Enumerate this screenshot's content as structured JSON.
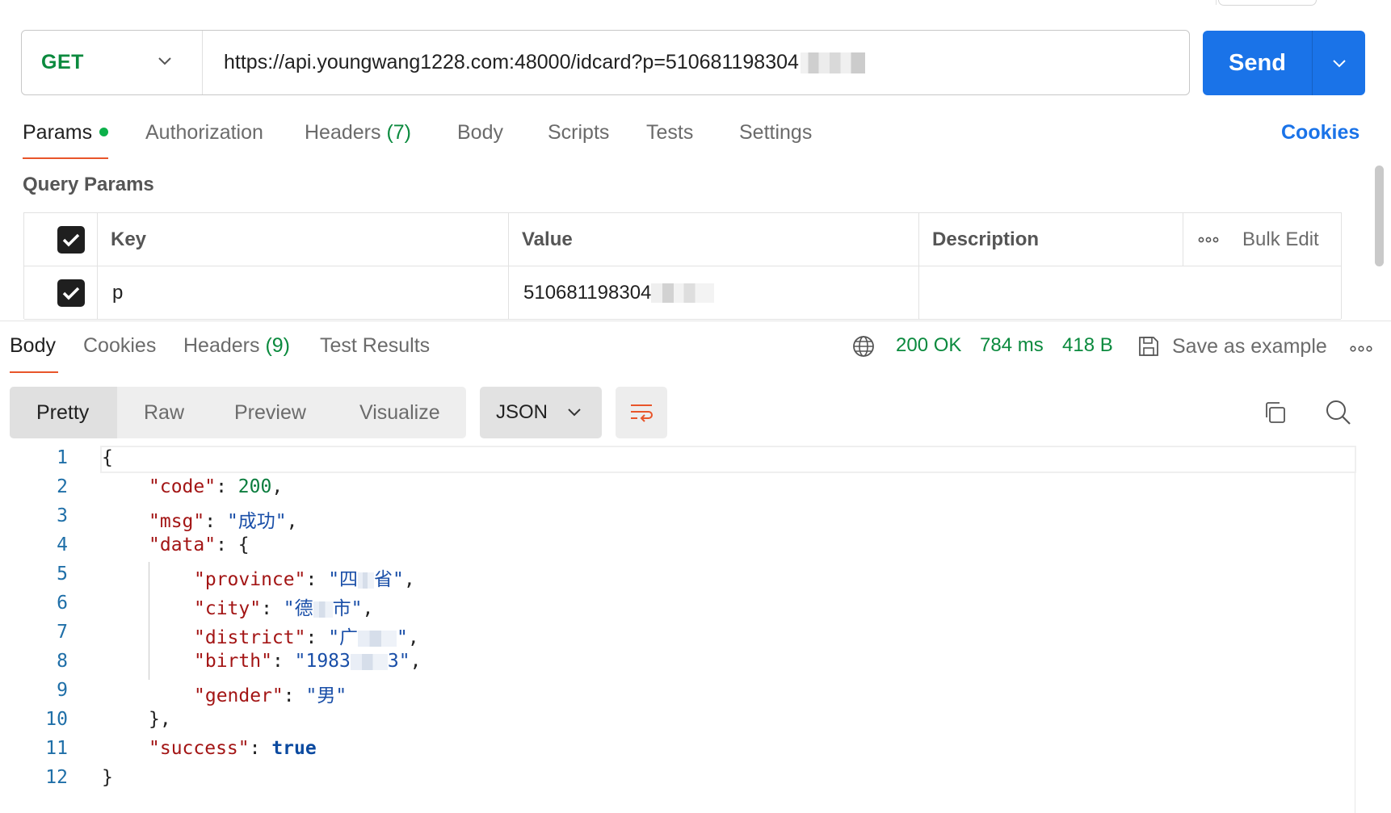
{
  "request": {
    "method": "GET",
    "url": "https://api.youngwang1228.com:48000/idcard?p=510681198304",
    "send_label": "Send"
  },
  "request_tabs": {
    "params": "Params",
    "authorization": "Authorization",
    "headers": "Headers",
    "headers_count": "(7)",
    "body": "Body",
    "scripts": "Scripts",
    "tests": "Tests",
    "settings": "Settings",
    "cookies": "Cookies"
  },
  "query_params": {
    "title": "Query Params",
    "columns": {
      "key": "Key",
      "value": "Value",
      "description": "Description",
      "bulk_edit": "Bulk Edit"
    },
    "rows": [
      {
        "key": "p",
        "value": "510681198304",
        "description": "",
        "checked": true
      }
    ]
  },
  "response": {
    "tabs": {
      "body": "Body",
      "cookies": "Cookies",
      "headers": "Headers",
      "headers_count": "(9)",
      "test_results": "Test Results"
    },
    "status": "200 OK",
    "time": "784 ms",
    "size": "418 B",
    "save_label": "Save as example",
    "view_modes": [
      "Pretty",
      "Raw",
      "Preview",
      "Visualize"
    ],
    "format": "JSON",
    "code": {
      "l1": "{",
      "code_key": "\"code\"",
      "code_val": "200",
      "msg_key": "\"msg\"",
      "msg_val": "\"成功\"",
      "data_key": "\"data\"",
      "province_key": "\"province\"",
      "province_a": "\"四",
      "province_b": "省\"",
      "city_key": "\"city\"",
      "city_a": "\"德",
      "city_b": "市\"",
      "district_key": "\"district\"",
      "district_a": "\"广",
      "district_b": "\"",
      "birth_key": "\"birth\"",
      "birth_a": "\"1983",
      "birth_b": "3\"",
      "gender_key": "\"gender\"",
      "gender_val": "\"男\"",
      "data_close": "},",
      "success_key": "\"success\"",
      "success_val": "true",
      "l12": "}"
    }
  }
}
